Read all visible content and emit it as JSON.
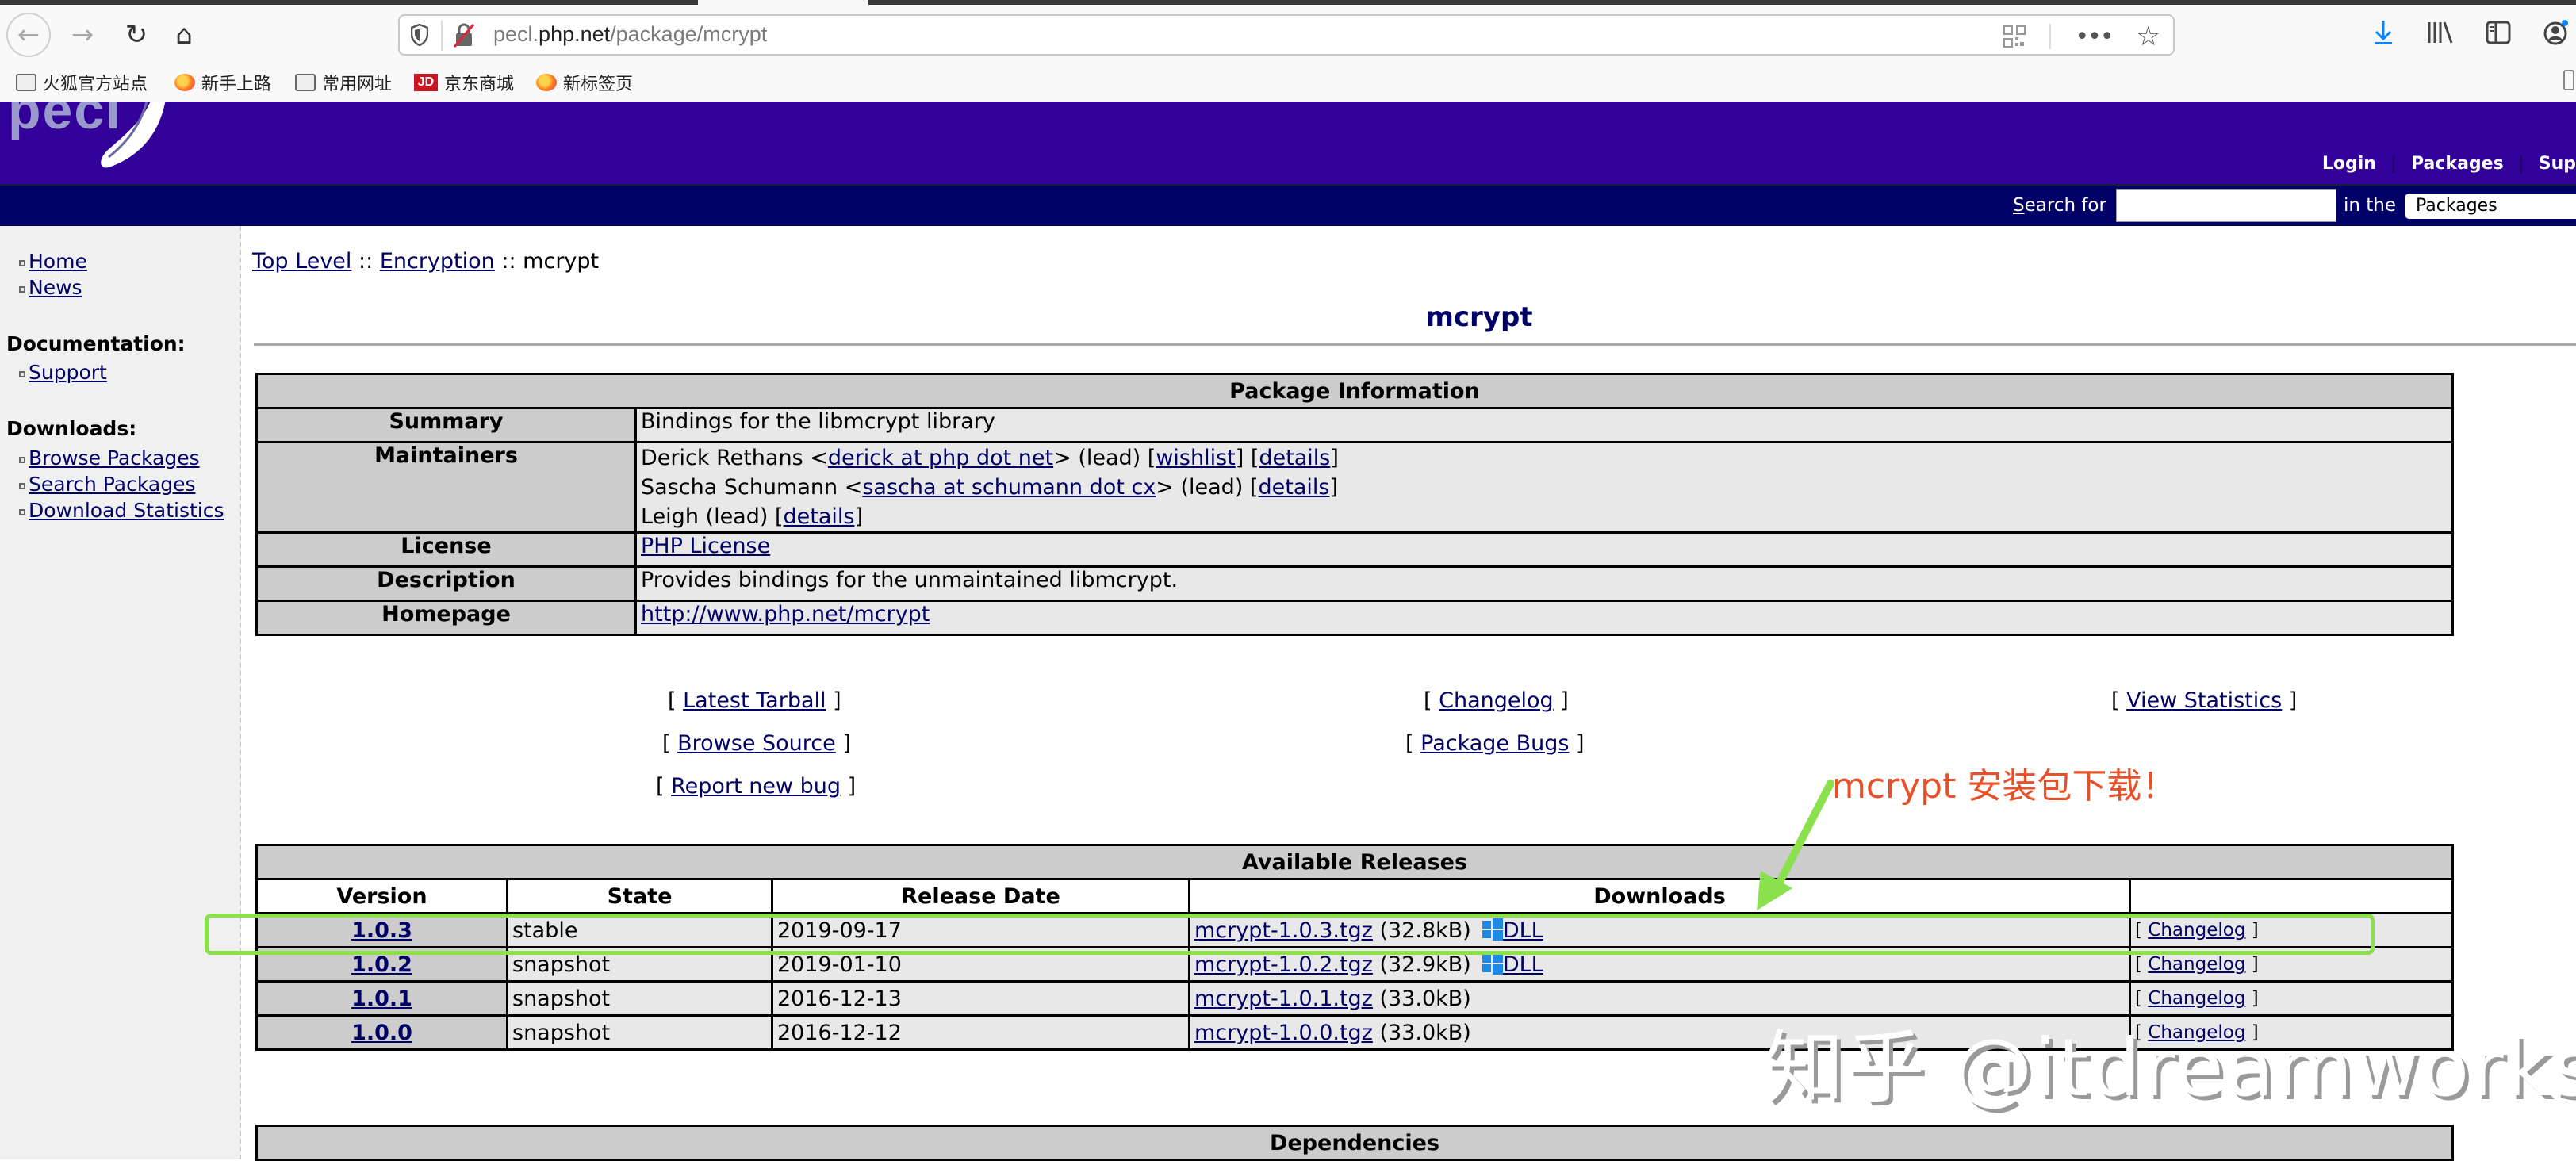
{
  "browser": {
    "url_host": "pecl.php.net",
    "url_prefix": "pecl.",
    "url_domain": "php.net",
    "url_path": "/package/mcrypt",
    "bookmarks": [
      {
        "label": "火狐官方站点",
        "icon": "folder-icon"
      },
      {
        "label": "新手上路",
        "icon": "firefox-icon"
      },
      {
        "label": "常用网址",
        "icon": "folder-icon"
      },
      {
        "label": "京东商城",
        "icon": "jd-icon"
      },
      {
        "label": "新标签页",
        "icon": "firefox-icon"
      }
    ],
    "jd_icon_text": "JD"
  },
  "site": {
    "logo": "pecl",
    "top_links": [
      "Login",
      "Packages",
      "Sup"
    ],
    "search_label_first": "S",
    "search_label_rest": "earch for",
    "search_value": "",
    "in_the": "in the",
    "search_scope": "Packages"
  },
  "sidebar": {
    "top_items": [
      "Home",
      "News"
    ],
    "documentation_heading": "Documentation:",
    "documentation_items": [
      "Support"
    ],
    "downloads_heading": "Downloads:",
    "downloads_items": [
      "Browse Packages",
      "Search Packages",
      "Download Statistics"
    ]
  },
  "breadcrumb": {
    "items": [
      "Top Level",
      "Encryption"
    ],
    "separator": "::",
    "current": "mcrypt"
  },
  "page_title": "mcrypt",
  "package_info": {
    "title": "Package Information",
    "summary_label": "Summary",
    "summary": "Bindings for the libmcrypt library",
    "maintainers_label": "Maintainers",
    "maintainers": [
      {
        "name": "Derick Rethans",
        "email": "derick at php dot net",
        "role": "(lead)",
        "links": [
          "wishlist",
          "details"
        ]
      },
      {
        "name": "Sascha Schumann",
        "email": "sascha at schumann dot cx",
        "role": "(lead)",
        "links": [
          "details"
        ]
      },
      {
        "name": "Leigh",
        "email": "",
        "role": "(lead)",
        "links": [
          "details"
        ]
      }
    ],
    "license_label": "License",
    "license": "PHP License",
    "description_label": "Description",
    "description": "Provides bindings for the unmaintained libmcrypt.",
    "homepage_label": "Homepage",
    "homepage": "http://www.php.net/mcrypt"
  },
  "package_links": {
    "latest_tarball": "Latest Tarball",
    "changelog": "Changelog",
    "view_statistics": "View Statistics",
    "browse_source": "Browse Source",
    "package_bugs": "Package Bugs",
    "report_new_bug": "Report new bug"
  },
  "releases": {
    "title": "Available Releases",
    "columns": [
      "Version",
      "State",
      "Release Date",
      "Downloads",
      ""
    ],
    "rows": [
      {
        "version": "1.0.3",
        "state": "stable",
        "date": "2019-09-17",
        "file": "mcrypt-1.0.3.tgz",
        "size": "(32.8kB)",
        "dll": "DLL",
        "changelog": "Changelog",
        "highlighted": true
      },
      {
        "version": "1.0.2",
        "state": "snapshot",
        "date": "2019-01-10",
        "file": "mcrypt-1.0.2.tgz",
        "size": "(32.9kB)",
        "dll": "DLL",
        "changelog": "Changelog",
        "highlighted": false
      },
      {
        "version": "1.0.1",
        "state": "snapshot",
        "date": "2016-12-13",
        "file": "mcrypt-1.0.1.tgz",
        "size": "(33.0kB)",
        "dll": null,
        "changelog": "Changelog",
        "highlighted": false
      },
      {
        "version": "1.0.0",
        "state": "snapshot",
        "date": "2016-12-12",
        "file": "mcrypt-1.0.0.tgz",
        "size": "(33.0kB)",
        "dll": null,
        "changelog": "Changelog",
        "highlighted": false
      }
    ]
  },
  "dependencies": {
    "title": "Dependencies"
  },
  "annotation": {
    "text": "mcrypt 安装包下载！",
    "text_color": "#e8502a",
    "highlight_color": "#8be04e"
  },
  "watermark": "知乎 @itdreamworks",
  "colors": {
    "header_purple": "#330099",
    "header_navy": "#000066",
    "link": "#000066",
    "table_header_gray": "#cccccc",
    "table_cell_gray": "#e8e8e8",
    "windows_blue": "#1e88e5",
    "download_blue": "#0a84ff"
  }
}
